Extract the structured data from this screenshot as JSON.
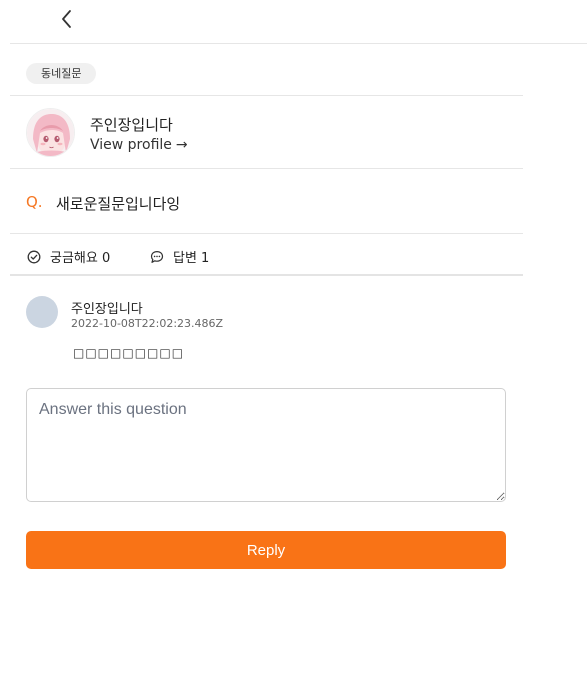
{
  "header": {
    "back_icon": "chevron-left-icon"
  },
  "category": {
    "label": "동네질문"
  },
  "author": {
    "name": "주인장입니다",
    "view_profile_label": "View profile",
    "view_profile_arrow": "→"
  },
  "question": {
    "prefix": "Q.",
    "title": "새로운질문입니다잉"
  },
  "stats": {
    "curious_label": "궁금해요 0",
    "answers_label": "답변 1"
  },
  "answers": [
    {
      "author": "주인장입니다",
      "timestamp": "2022-10-08T22:02:23.486Z",
      "body": "□□□□□□□□□"
    }
  ],
  "answer_form": {
    "placeholder": "Answer this question",
    "submit_label": "Reply"
  },
  "colors": {
    "accent": "#f97316",
    "question_mark": "#f57723",
    "avatar_placeholder": "#cbd5e1"
  }
}
